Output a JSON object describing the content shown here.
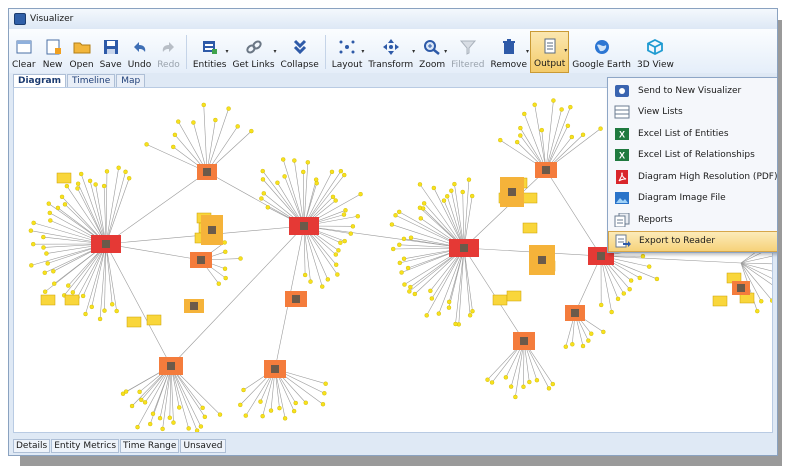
{
  "window": {
    "title": "Visualizer"
  },
  "toolbar": {
    "buttons": [
      {
        "id": "clear",
        "label": "Clear",
        "icon": "clear-icon",
        "enabled": true
      },
      {
        "id": "new",
        "label": "New",
        "icon": "new-icon",
        "enabled": true
      },
      {
        "id": "open",
        "label": "Open",
        "icon": "open-folder-icon",
        "enabled": true
      },
      {
        "id": "save",
        "label": "Save",
        "icon": "save-icon",
        "enabled": true
      },
      {
        "id": "undo",
        "label": "Undo",
        "icon": "undo-icon",
        "enabled": true
      },
      {
        "id": "redo",
        "label": "Redo",
        "icon": "redo-icon",
        "enabled": false
      },
      {
        "id": "entities",
        "label": "Entities",
        "icon": "entities-icon",
        "enabled": true
      },
      {
        "id": "get-links",
        "label": "Get Links",
        "icon": "link-icon",
        "enabled": true
      },
      {
        "id": "collapse",
        "label": "Collapse",
        "icon": "collapse-icon",
        "enabled": true
      },
      {
        "id": "layout",
        "label": "Layout",
        "icon": "layout-icon",
        "enabled": true
      },
      {
        "id": "transform",
        "label": "Transform",
        "icon": "transform-icon",
        "enabled": true
      },
      {
        "id": "zoom",
        "label": "Zoom",
        "icon": "zoom-icon",
        "enabled": true
      },
      {
        "id": "filtered",
        "label": "Filtered",
        "icon": "filter-icon",
        "enabled": false
      },
      {
        "id": "remove",
        "label": "Remove",
        "icon": "trash-icon",
        "enabled": true
      },
      {
        "id": "output",
        "label": "Output",
        "icon": "output-icon",
        "enabled": true
      },
      {
        "id": "google-earth",
        "label": "Google Earth",
        "icon": "globe-icon",
        "enabled": true
      },
      {
        "id": "3d-view",
        "label": "3D View",
        "icon": "cube-icon",
        "enabled": true
      }
    ]
  },
  "tabs": [
    {
      "label": "Diagram",
      "active": true
    },
    {
      "label": "Timeline",
      "active": false
    },
    {
      "label": "Map",
      "active": false
    }
  ],
  "output_menu": {
    "items": [
      {
        "label": "Send to New Visualizer",
        "icon": "visualizer-icon"
      },
      {
        "label": "View Lists",
        "icon": "list-icon"
      },
      {
        "label": "Excel List of Entities",
        "icon": "excel-icon"
      },
      {
        "label": "Excel List of Relationships",
        "icon": "excel-icon"
      },
      {
        "label": "Diagram High Resolution (PDF)",
        "icon": "pdf-icon"
      },
      {
        "label": "Diagram Image File",
        "icon": "image-icon"
      },
      {
        "label": "Reports",
        "icon": "reports-icon"
      },
      {
        "label": "Export to Reader",
        "icon": "export-icon",
        "highlighted": true
      }
    ]
  },
  "statusbar": {
    "items": [
      "Details",
      "Entity Metrics",
      "Time Range",
      "Unsaved"
    ]
  },
  "colors": {
    "primary_node": "#e53935",
    "secondary_node": "#f47c3c",
    "tertiary_node": "#f5b33a",
    "leaf_node": "#f7e11d",
    "edge": "#9a9a9a",
    "highlight": "#f6d27a"
  }
}
